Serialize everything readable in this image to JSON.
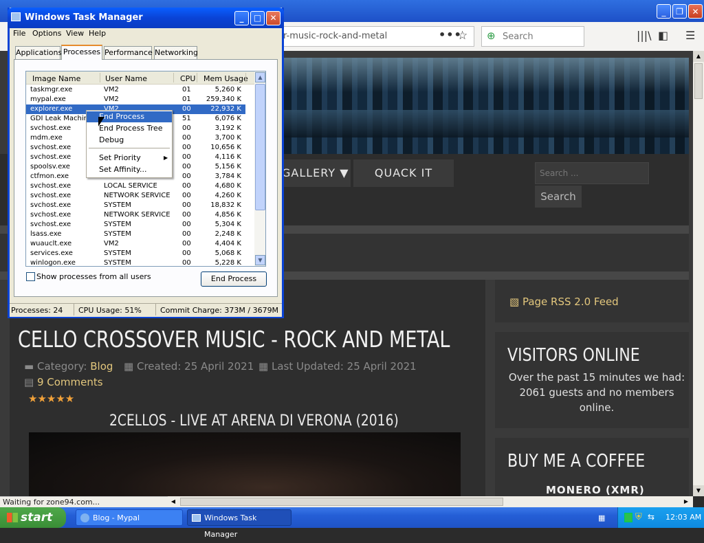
{
  "browser": {
    "url": "r-music-rock-and-metal",
    "search_placeholder": "Search",
    "status_text": "Waiting for zone94.com...",
    "more_icon": "•••",
    "star_icon": "☆",
    "library_icon": "|||\\",
    "sidebar_icon": "◧",
    "menu_icon": "☰"
  },
  "site": {
    "nav": [
      "GALLERY ▼",
      "QUACK IT"
    ],
    "search_placeholder": "Search ...",
    "search_button": "Search",
    "article_title": "CELLO CROSSOVER MUSIC - ROCK AND METAL",
    "category_label": "Category:",
    "category_value": "Blog",
    "created": "Created: 25 April 2021",
    "updated": "Last Updated: 25 April 2021",
    "comments": "9 Comments",
    "rating": "★★★★★",
    "video_title": "2CELLOS - LIVE AT ARENA DI VERONA (2016)",
    "rss": "Page RSS 2.0 Feed",
    "visitors_title": "VISITORS ONLINE",
    "visitors_text": "Over the past 15 minutes we had: 2061 guests and no members online.",
    "coffee_title": "BUY ME A COFFEE",
    "monero": "MONERO (XMR)"
  },
  "taskmanager": {
    "title": "Windows Task Manager",
    "menu": [
      "File",
      "Options",
      "View",
      "Help"
    ],
    "tabs": [
      "Applications",
      "Processes",
      "Performance",
      "Networking"
    ],
    "active_tab": "Processes",
    "columns": [
      "Image Name",
      "User Name",
      "CPU",
      "Mem Usage"
    ],
    "rows": [
      {
        "image": "taskmgr.exe",
        "user": "VM2",
        "cpu": "01",
        "mem": "5,260 K"
      },
      {
        "image": "mypal.exe",
        "user": "VM2",
        "cpu": "01",
        "mem": "259,340 K"
      },
      {
        "image": "explorer.exe",
        "user": "VM2",
        "cpu": "00",
        "mem": "22,932 K"
      },
      {
        "image": "GDI Leak Machine",
        "user": "",
        "cpu": "51",
        "mem": "6,076 K"
      },
      {
        "image": "svchost.exe",
        "user": "",
        "cpu": "00",
        "mem": "3,192 K"
      },
      {
        "image": "mdm.exe",
        "user": "",
        "cpu": "00",
        "mem": "3,700 K"
      },
      {
        "image": "svchost.exe",
        "user": "",
        "cpu": "00",
        "mem": "10,656 K"
      },
      {
        "image": "svchost.exe",
        "user": "",
        "cpu": "00",
        "mem": "4,116 K"
      },
      {
        "image": "spoolsv.exe",
        "user": "",
        "cpu": "00",
        "mem": "5,156 K"
      },
      {
        "image": "ctfmon.exe",
        "user": "",
        "cpu": "00",
        "mem": "3,784 K"
      },
      {
        "image": "svchost.exe",
        "user": "LOCAL SERVICE",
        "cpu": "00",
        "mem": "4,680 K"
      },
      {
        "image": "svchost.exe",
        "user": "NETWORK SERVICE",
        "cpu": "00",
        "mem": "4,260 K"
      },
      {
        "image": "svchost.exe",
        "user": "SYSTEM",
        "cpu": "00",
        "mem": "18,832 K"
      },
      {
        "image": "svchost.exe",
        "user": "NETWORK SERVICE",
        "cpu": "00",
        "mem": "4,856 K"
      },
      {
        "image": "svchost.exe",
        "user": "SYSTEM",
        "cpu": "00",
        "mem": "5,304 K"
      },
      {
        "image": "lsass.exe",
        "user": "SYSTEM",
        "cpu": "00",
        "mem": "2,248 K"
      },
      {
        "image": "wuauclt.exe",
        "user": "VM2",
        "cpu": "00",
        "mem": "4,404 K"
      },
      {
        "image": "services.exe",
        "user": "SYSTEM",
        "cpu": "00",
        "mem": "5,068 K"
      },
      {
        "image": "winlogon.exe",
        "user": "SYSTEM",
        "cpu": "00",
        "mem": "5,228 K"
      }
    ],
    "selected_row": 2,
    "show_all_label": "Show processes from all users",
    "end_process_button": "End Process",
    "status_processes": "Processes: 24",
    "status_cpu": "CPU Usage: 51%",
    "status_commit": "Commit Charge: 373M / 3679M"
  },
  "context_menu": {
    "items": [
      "End Process",
      "End Process Tree",
      "Debug",
      "Set Priority",
      "Set Affinity..."
    ],
    "highlighted": "End Process"
  },
  "taskbar": {
    "start": "start",
    "tasks": [
      "Blog - Mypal",
      "Windows Task Manager"
    ],
    "clock": "12:03 AM"
  },
  "colors": {
    "accent_link": "#e3c77d",
    "selection": "#316ac5",
    "xp_title": "#0a43d6",
    "star": "#f2a23a"
  }
}
